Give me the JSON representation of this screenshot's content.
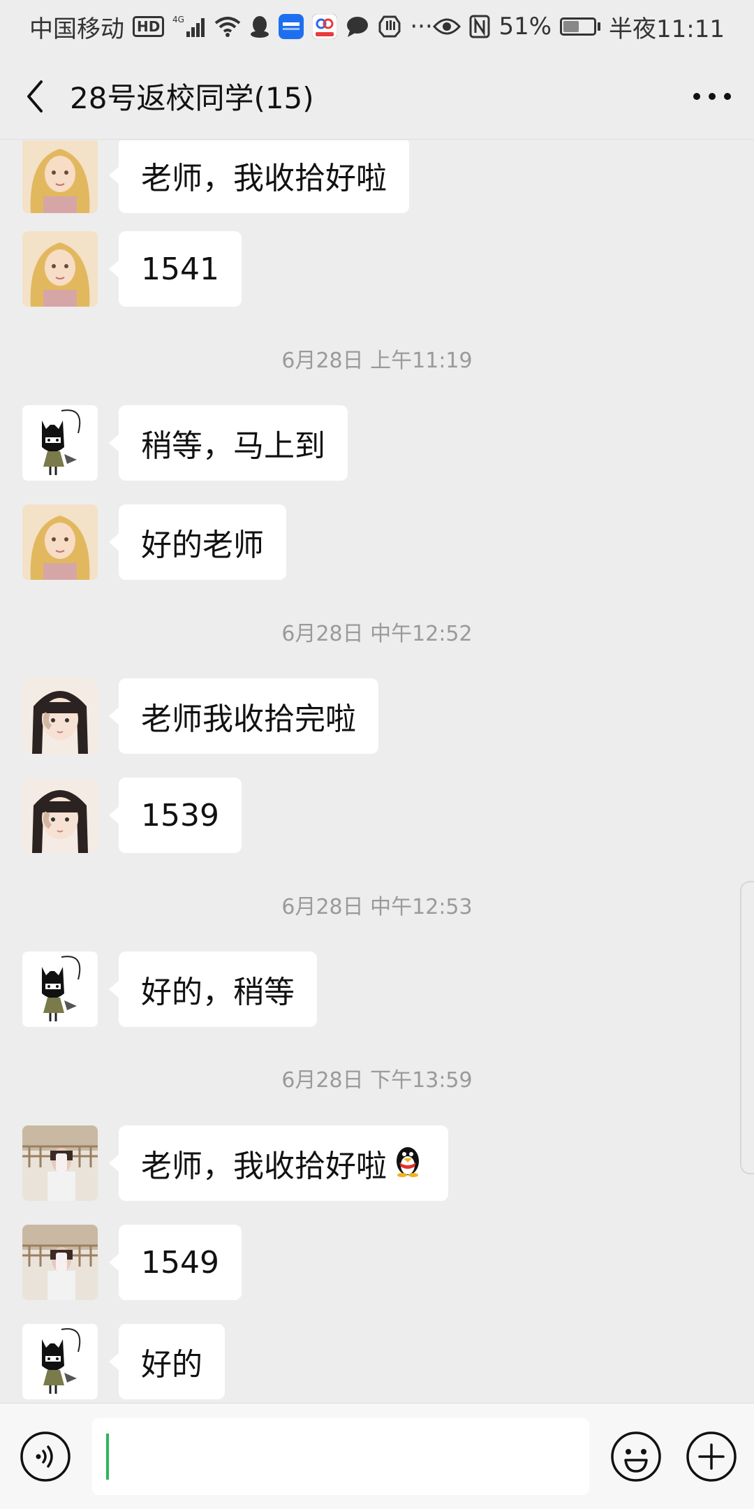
{
  "status_bar": {
    "carrier": "中国移动",
    "hd": "HD",
    "network": "4G",
    "ellipsis": "···",
    "battery_percent_label": "51%",
    "battery_level": 0.51,
    "time": "半夜11:11"
  },
  "header": {
    "title": "28号返校同学(15)"
  },
  "messages": [
    {
      "text": "老师，我收拾好啦",
      "avatar": "avatar-blonde"
    },
    {
      "text": "1541",
      "avatar": "avatar-blonde"
    },
    {
      "timestamp": "6月28日 上午11:19"
    },
    {
      "text": "稍等，马上到",
      "avatar": "avatar-batman"
    },
    {
      "text": "好的老师",
      "avatar": "avatar-blonde"
    },
    {
      "timestamp": "6月28日 中午12:52"
    },
    {
      "text": "老师我收拾完啦",
      "avatar": "avatar-girl"
    },
    {
      "text": "1539",
      "avatar": "avatar-girl"
    },
    {
      "timestamp": "6月28日 中午12:53"
    },
    {
      "text": "好的，稍等",
      "avatar": "avatar-batman"
    },
    {
      "timestamp": "6月28日 下午13:59"
    },
    {
      "text": "老师，我收拾好啦",
      "avatar": "avatar-photo",
      "emoji": "penguin-icon"
    },
    {
      "text": "1549",
      "avatar": "avatar-photo"
    },
    {
      "text": "好的",
      "avatar": "avatar-batman"
    }
  ],
  "colors": {
    "background": "#EDEDED",
    "bubble": "#FFFFFF",
    "caret": "#2DB55D",
    "timestamp": "#9A9A9A"
  }
}
